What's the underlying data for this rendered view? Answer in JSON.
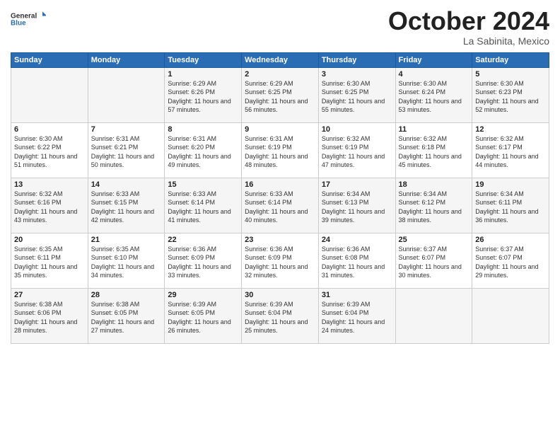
{
  "header": {
    "logo_general": "General",
    "logo_blue": "Blue",
    "month": "October 2024",
    "location": "La Sabinita, Mexico"
  },
  "weekdays": [
    "Sunday",
    "Monday",
    "Tuesday",
    "Wednesday",
    "Thursday",
    "Friday",
    "Saturday"
  ],
  "weeks": [
    [
      {
        "day": "",
        "info": ""
      },
      {
        "day": "",
        "info": ""
      },
      {
        "day": "1",
        "info": "Sunrise: 6:29 AM\nSunset: 6:26 PM\nDaylight: 11 hours and 57 minutes."
      },
      {
        "day": "2",
        "info": "Sunrise: 6:29 AM\nSunset: 6:25 PM\nDaylight: 11 hours and 56 minutes."
      },
      {
        "day": "3",
        "info": "Sunrise: 6:30 AM\nSunset: 6:25 PM\nDaylight: 11 hours and 55 minutes."
      },
      {
        "day": "4",
        "info": "Sunrise: 6:30 AM\nSunset: 6:24 PM\nDaylight: 11 hours and 53 minutes."
      },
      {
        "day": "5",
        "info": "Sunrise: 6:30 AM\nSunset: 6:23 PM\nDaylight: 11 hours and 52 minutes."
      }
    ],
    [
      {
        "day": "6",
        "info": "Sunrise: 6:30 AM\nSunset: 6:22 PM\nDaylight: 11 hours and 51 minutes."
      },
      {
        "day": "7",
        "info": "Sunrise: 6:31 AM\nSunset: 6:21 PM\nDaylight: 11 hours and 50 minutes."
      },
      {
        "day": "8",
        "info": "Sunrise: 6:31 AM\nSunset: 6:20 PM\nDaylight: 11 hours and 49 minutes."
      },
      {
        "day": "9",
        "info": "Sunrise: 6:31 AM\nSunset: 6:19 PM\nDaylight: 11 hours and 48 minutes."
      },
      {
        "day": "10",
        "info": "Sunrise: 6:32 AM\nSunset: 6:19 PM\nDaylight: 11 hours and 47 minutes."
      },
      {
        "day": "11",
        "info": "Sunrise: 6:32 AM\nSunset: 6:18 PM\nDaylight: 11 hours and 45 minutes."
      },
      {
        "day": "12",
        "info": "Sunrise: 6:32 AM\nSunset: 6:17 PM\nDaylight: 11 hours and 44 minutes."
      }
    ],
    [
      {
        "day": "13",
        "info": "Sunrise: 6:32 AM\nSunset: 6:16 PM\nDaylight: 11 hours and 43 minutes."
      },
      {
        "day": "14",
        "info": "Sunrise: 6:33 AM\nSunset: 6:15 PM\nDaylight: 11 hours and 42 minutes."
      },
      {
        "day": "15",
        "info": "Sunrise: 6:33 AM\nSunset: 6:14 PM\nDaylight: 11 hours and 41 minutes."
      },
      {
        "day": "16",
        "info": "Sunrise: 6:33 AM\nSunset: 6:14 PM\nDaylight: 11 hours and 40 minutes."
      },
      {
        "day": "17",
        "info": "Sunrise: 6:34 AM\nSunset: 6:13 PM\nDaylight: 11 hours and 39 minutes."
      },
      {
        "day": "18",
        "info": "Sunrise: 6:34 AM\nSunset: 6:12 PM\nDaylight: 11 hours and 38 minutes."
      },
      {
        "day": "19",
        "info": "Sunrise: 6:34 AM\nSunset: 6:11 PM\nDaylight: 11 hours and 36 minutes."
      }
    ],
    [
      {
        "day": "20",
        "info": "Sunrise: 6:35 AM\nSunset: 6:11 PM\nDaylight: 11 hours and 35 minutes."
      },
      {
        "day": "21",
        "info": "Sunrise: 6:35 AM\nSunset: 6:10 PM\nDaylight: 11 hours and 34 minutes."
      },
      {
        "day": "22",
        "info": "Sunrise: 6:36 AM\nSunset: 6:09 PM\nDaylight: 11 hours and 33 minutes."
      },
      {
        "day": "23",
        "info": "Sunrise: 6:36 AM\nSunset: 6:09 PM\nDaylight: 11 hours and 32 minutes."
      },
      {
        "day": "24",
        "info": "Sunrise: 6:36 AM\nSunset: 6:08 PM\nDaylight: 11 hours and 31 minutes."
      },
      {
        "day": "25",
        "info": "Sunrise: 6:37 AM\nSunset: 6:07 PM\nDaylight: 11 hours and 30 minutes."
      },
      {
        "day": "26",
        "info": "Sunrise: 6:37 AM\nSunset: 6:07 PM\nDaylight: 11 hours and 29 minutes."
      }
    ],
    [
      {
        "day": "27",
        "info": "Sunrise: 6:38 AM\nSunset: 6:06 PM\nDaylight: 11 hours and 28 minutes."
      },
      {
        "day": "28",
        "info": "Sunrise: 6:38 AM\nSunset: 6:05 PM\nDaylight: 11 hours and 27 minutes."
      },
      {
        "day": "29",
        "info": "Sunrise: 6:39 AM\nSunset: 6:05 PM\nDaylight: 11 hours and 26 minutes."
      },
      {
        "day": "30",
        "info": "Sunrise: 6:39 AM\nSunset: 6:04 PM\nDaylight: 11 hours and 25 minutes."
      },
      {
        "day": "31",
        "info": "Sunrise: 6:39 AM\nSunset: 6:04 PM\nDaylight: 11 hours and 24 minutes."
      },
      {
        "day": "",
        "info": ""
      },
      {
        "day": "",
        "info": ""
      }
    ]
  ]
}
